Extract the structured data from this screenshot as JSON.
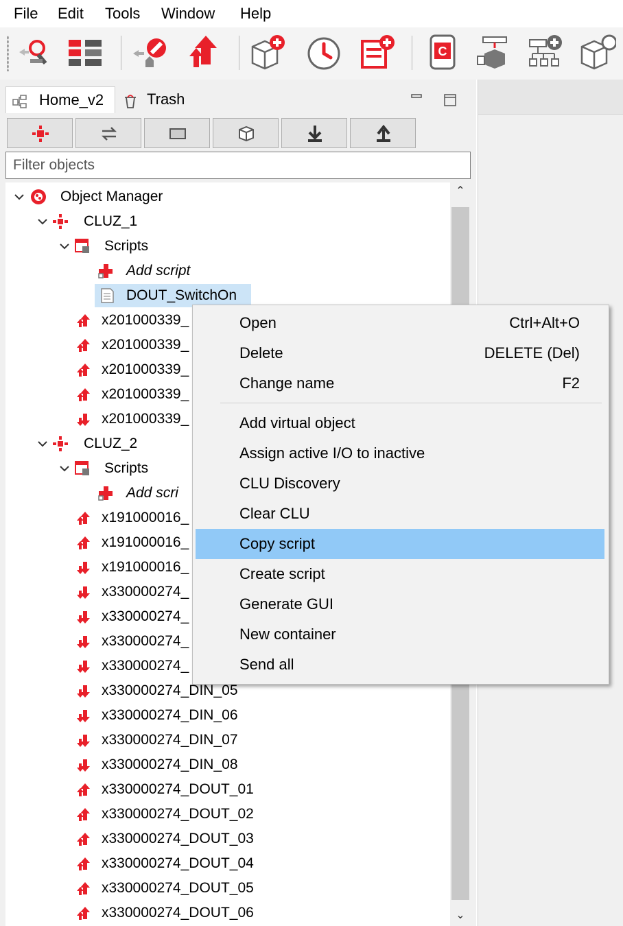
{
  "menubar": {
    "items": [
      "File",
      "Edit",
      "Tools",
      "Window",
      "Help"
    ]
  },
  "toolbar": {
    "icons": [
      "find-icon",
      "layout-icon",
      "cancel-icon",
      "send-icon",
      "add-object-icon",
      "timer-icon",
      "add-list-icon",
      "device-icon",
      "tree-package-icon",
      "add-tree-icon",
      "rotate-object-icon"
    ]
  },
  "panel": {
    "tabs": [
      {
        "label": "Home_v2",
        "icon": "home-tree-icon"
      },
      {
        "label": "Trash",
        "icon": "trash-icon"
      }
    ],
    "filter_placeholder": "Filter objects"
  },
  "tree": {
    "root": "Object Manager",
    "cluz1": {
      "label": "CLUZ_1",
      "scripts_label": "Scripts",
      "add_script": "Add script",
      "selected_script": "DOUT_SwitchOn",
      "items": [
        "x201000339_",
        "x201000339_",
        "x201000339_",
        "x201000339_",
        "x201000339_"
      ]
    },
    "cluz2": {
      "label": "CLUZ_2",
      "scripts_label": "Scripts",
      "add_script": "Add scri",
      "items": [
        "x191000016_",
        "x191000016_",
        "x191000016_",
        "x330000274_",
        "x330000274_",
        "x330000274_",
        "x330000274_",
        "x330000274_DIN_05",
        "x330000274_DIN_06",
        "x330000274_DIN_07",
        "x330000274_DIN_08",
        "x330000274_DOUT_01",
        "x330000274_DOUT_02",
        "x330000274_DOUT_03",
        "x330000274_DOUT_04",
        "x330000274_DOUT_05",
        "x330000274_DOUT_06"
      ]
    }
  },
  "context_menu": {
    "group1": [
      {
        "label": "Open",
        "shortcut": "Ctrl+Alt+O"
      },
      {
        "label": "Delete",
        "shortcut": "DELETE (Del)"
      },
      {
        "label": "Change name",
        "shortcut": "F2"
      }
    ],
    "group2": [
      {
        "label": "Add virtual object"
      },
      {
        "label": "Assign active I/O to inactive"
      },
      {
        "label": "CLU Discovery"
      },
      {
        "label": "Clear CLU"
      },
      {
        "label": "Copy script",
        "highlighted": true
      },
      {
        "label": "Create script"
      },
      {
        "label": "Generate GUI"
      },
      {
        "label": "New container"
      },
      {
        "label": "Send all"
      }
    ]
  },
  "colors": {
    "accent_red": "#e8202a",
    "selection": "#cce4f7",
    "menu_highlight": "#91c9f7"
  }
}
